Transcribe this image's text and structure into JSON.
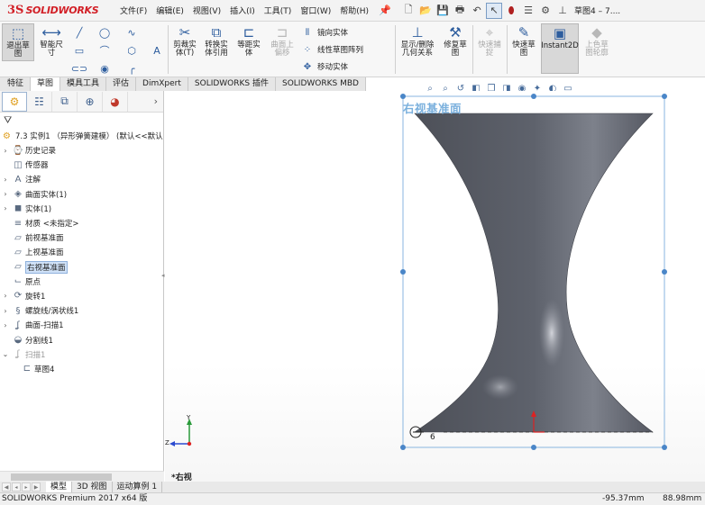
{
  "app": {
    "logo_ds": "3S",
    "logo_text": "SOLIDWORKS"
  },
  "menus": [
    "文件(F)",
    "编辑(E)",
    "视图(V)",
    "插入(I)",
    "工具(T)",
    "窗口(W)",
    "帮助(H)"
  ],
  "quick_icons": [
    "new-icon",
    "open-icon",
    "save-icon",
    "print-icon",
    "undo-icon",
    "select-icon",
    "traffic-light-icon",
    "file-props-icon",
    "options-icon",
    "down-icon"
  ],
  "document_title": "草图4 – 7....",
  "commands": {
    "exit_sketch": "退出草\n图",
    "smart_dim": "智能尺\n寸",
    "trim": "剪裁实\n体(T)",
    "convert": "转换实\n体引用",
    "offset": "等距实\n体",
    "surface_offset": "曲面上\n偏移",
    "mirror": "镜向实体",
    "linear_pattern": "线性草图阵列",
    "move": "移动实体",
    "show_relations": "显示/删除\n几何关系",
    "repair": "修复草\n图",
    "snap": "快速捕\n捉",
    "rapid_sketch": "快速草\n图",
    "instant2d": "Instant2D",
    "shaded": "上色草\n图轮廓"
  },
  "tabs": [
    {
      "label": "特征",
      "active": false
    },
    {
      "label": "草图",
      "active": true
    },
    {
      "label": "模具工具",
      "active": false
    },
    {
      "label": "评估",
      "active": false
    },
    {
      "label": "DimXpert",
      "active": false
    },
    {
      "label": "SOLIDWORKS 插件",
      "active": false
    },
    {
      "label": "SOLIDWORKS MBD",
      "active": false
    }
  ],
  "feature_manager": {
    "root": "7.3 实例1 （异形弹簧建模） (默认<<默认",
    "items": [
      {
        "label": "历史记录",
        "icon": "history-icon",
        "expand": true
      },
      {
        "label": "传感器",
        "icon": "sensor-icon",
        "expand": false
      },
      {
        "label": "注解",
        "icon": "annotation-icon",
        "expand": true
      },
      {
        "label": "曲面实体(1)",
        "icon": "surface-body-icon",
        "expand": true
      },
      {
        "label": "实体(1)",
        "icon": "solid-body-icon",
        "expand": true
      },
      {
        "label": "材质 <未指定>",
        "icon": "material-icon",
        "expand": false
      },
      {
        "label": "前视基准面",
        "icon": "plane-icon",
        "expand": false
      },
      {
        "label": "上视基准面",
        "icon": "plane-icon",
        "expand": false
      },
      {
        "label": "右视基准面",
        "icon": "plane-icon",
        "expand": false,
        "selected": true
      },
      {
        "label": "原点",
        "icon": "origin-icon",
        "expand": false
      },
      {
        "label": "旋转1",
        "icon": "revolve-icon",
        "expand": true
      },
      {
        "label": "螺旋线/涡状线1",
        "icon": "helix-icon",
        "expand": true
      },
      {
        "label": "曲面-扫描1",
        "icon": "surface-sweep-icon",
        "expand": true
      },
      {
        "label": "分割线1",
        "icon": "split-line-icon",
        "expand": false
      },
      {
        "label": "扫描1",
        "icon": "sweep-icon",
        "expand": true,
        "greyed": true
      },
      {
        "label": "草图4",
        "icon": "sketch-icon",
        "expand": false,
        "child": true
      }
    ]
  },
  "graphics": {
    "plane_label": "右视基准面",
    "view_label": "*右视",
    "triad": {
      "y": "Y",
      "z": "Z"
    }
  },
  "bottom_tabs": [
    {
      "label": "模型",
      "active": true
    },
    {
      "label": "3D 视图",
      "active": false
    },
    {
      "label": "运动算例 1",
      "active": false
    }
  ],
  "status": {
    "product": "SOLIDWORKS Premium 2017 x64 版",
    "x": "-95.37mm",
    "y": "88.98mm"
  }
}
